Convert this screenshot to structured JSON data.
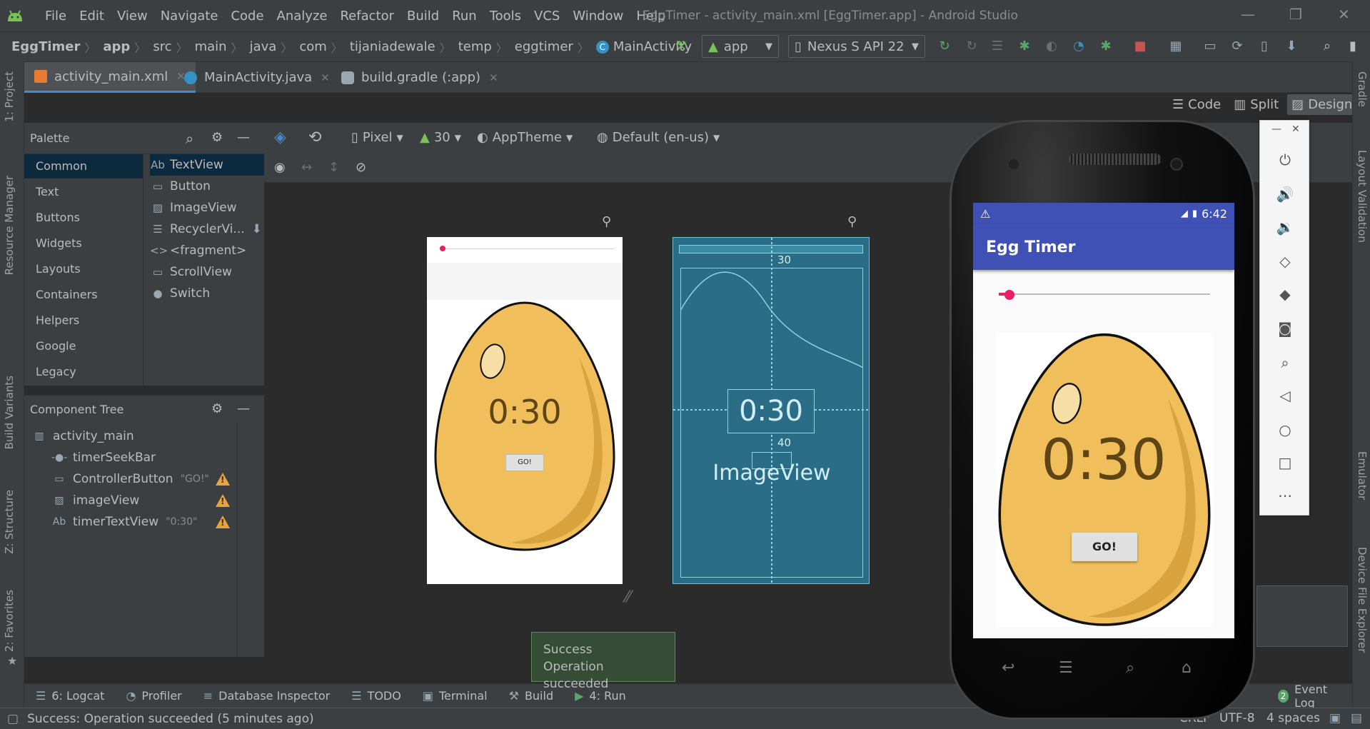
{
  "menubar": {
    "items": [
      "File",
      "Edit",
      "View",
      "Navigate",
      "Code",
      "Analyze",
      "Refactor",
      "Build",
      "Run",
      "Tools",
      "VCS",
      "Window",
      "Help"
    ],
    "title": "EggTimer - activity_main.xml [EggTimer.app] - Android Studio"
  },
  "breadcrumb": [
    "EggTimer",
    "app",
    "src",
    "main",
    "java",
    "com",
    "tijaniadewale",
    "temp",
    "eggtimer",
    "MainActivity"
  ],
  "toolbar": {
    "config": "app",
    "device": "Nexus S API 22"
  },
  "tabs": [
    "activity_main.xml",
    "MainActivity.java",
    "build.gradle (:app)"
  ],
  "mode": {
    "code": "Code",
    "split": "Split",
    "design": "Design"
  },
  "design_toolbar": {
    "device": "Pixel",
    "api": "30",
    "theme": "AppTheme",
    "locale": "Default (en-us)"
  },
  "palette": {
    "title": "Palette",
    "categories": [
      "Common",
      "Text",
      "Buttons",
      "Widgets",
      "Layouts",
      "Containers",
      "Helpers",
      "Google",
      "Legacy"
    ],
    "items": [
      {
        "icon": "Ab",
        "label": "TextView"
      },
      {
        "icon": "▭",
        "label": "Button"
      },
      {
        "icon": "▨",
        "label": "ImageView"
      },
      {
        "icon": "☰",
        "label": "RecyclerVi..."
      },
      {
        "icon": "<>",
        "label": "<fragment>"
      },
      {
        "icon": "▭",
        "label": "ScrollView"
      },
      {
        "icon": "●",
        "label": "Switch"
      }
    ]
  },
  "component_tree": {
    "title": "Component Tree",
    "root": "activity_main",
    "children": [
      {
        "label": "timerSeekBar",
        "quote": "",
        "warn": false
      },
      {
        "label": "ControllerButton",
        "quote": "\"GO!\"",
        "warn": true
      },
      {
        "label": "imageView",
        "quote": "",
        "warn": true
      },
      {
        "label": "timerTextView",
        "quote": "\"0:30\"",
        "warn": true
      }
    ]
  },
  "canvas": {
    "preview_time": "0:30",
    "preview_button": "GO!",
    "blueprint_time": "0:30",
    "blueprint_image_label": "ImageView",
    "blueprint_margin_top": "30",
    "blueprint_margin_mid": "40"
  },
  "left_strip": [
    "1: Project",
    "Resource Manager",
    "Build Variants",
    "Z: Structure",
    "2: Favorites"
  ],
  "right_strip": [
    "Gradle",
    "Layout Validation",
    "Emulator",
    "Device File Explorer"
  ],
  "bottom_tabs": [
    {
      "icon": "☰",
      "label": "6: Logcat"
    },
    {
      "icon": "◔",
      "label": "Profiler"
    },
    {
      "icon": "≡",
      "label": "Database Inspector"
    },
    {
      "icon": "☰",
      "label": "TODO"
    },
    {
      "icon": "▣",
      "label": "Terminal"
    },
    {
      "icon": "⚒",
      "label": "Build"
    },
    {
      "icon": "▶",
      "label": "4: Run"
    }
  ],
  "event_log": {
    "count": "2",
    "label": "Event Log"
  },
  "toast": {
    "title": "Success",
    "body": "Operation succeeded"
  },
  "status": {
    "message": "Success: Operation succeeded (5 minutes ago)",
    "line_sep": "CRLF",
    "encoding": "UTF-8",
    "indent": "4 spaces"
  },
  "phone": {
    "time": "6:42",
    "app_title": "Egg Timer",
    "timer_text": "0:30",
    "button_label": "GO!",
    "seek_progress": 0.05
  },
  "colors": {
    "accent": "#4a88c7",
    "android_green": "#78c257",
    "app_primary": "#3f51b5",
    "egg_fill": "#f0bf5c",
    "seek_accent": "#e91e63",
    "warn": "#e8a33d"
  }
}
